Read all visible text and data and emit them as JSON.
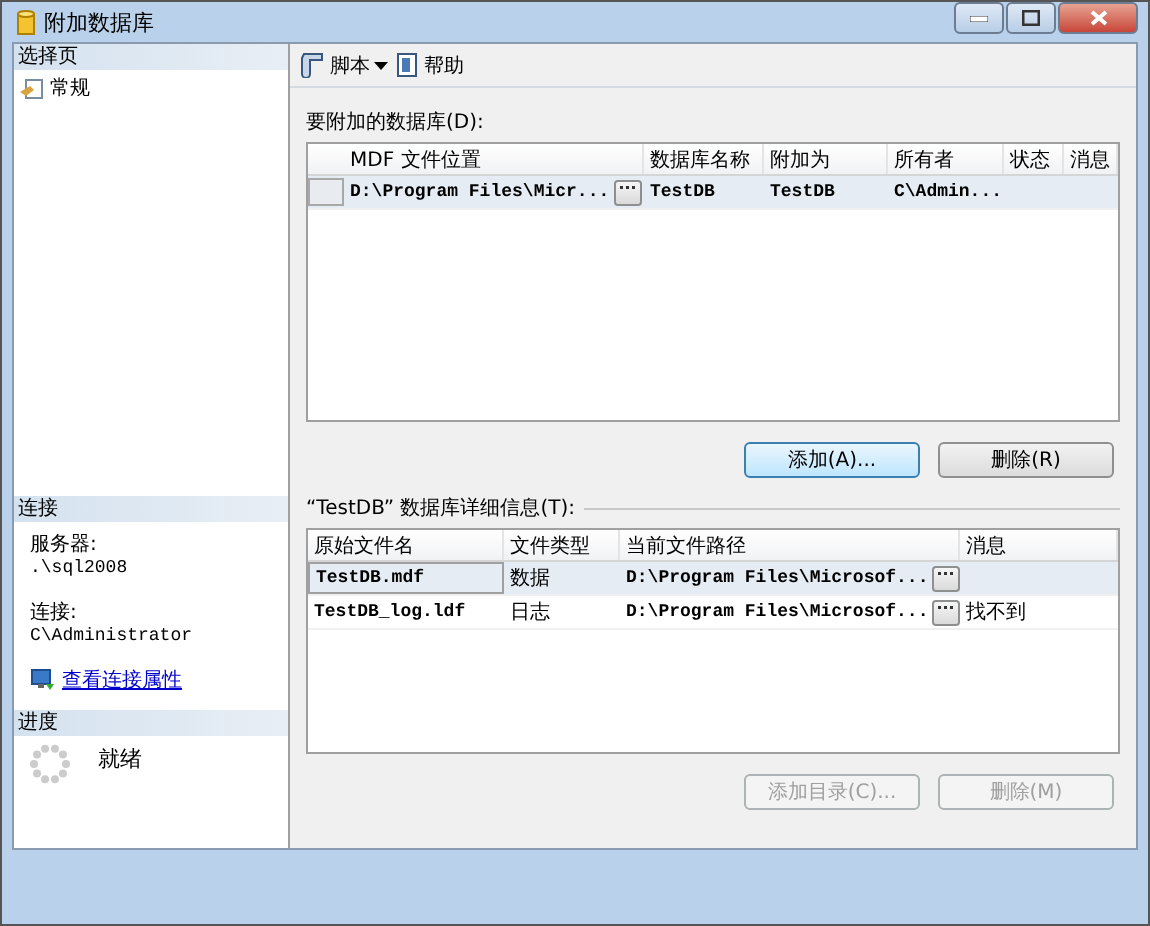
{
  "window": {
    "title": "附加数据库"
  },
  "pages": {
    "header": "选择页",
    "items": [
      {
        "label": "常规"
      }
    ]
  },
  "connection": {
    "header": "连接",
    "fields": [
      {
        "label": "服务器:",
        "value": ".\\sql2008"
      },
      {
        "label": "连接:",
        "value": "C\\Administrator"
      }
    ],
    "link": "查看连接属性"
  },
  "progress": {
    "header": "进度",
    "status": "就绪"
  },
  "toolbar": [
    {
      "label": "脚本",
      "kind": "dropdown"
    },
    {
      "label": "帮助",
      "kind": "help"
    }
  ],
  "databases": {
    "label": "要附加的数据库(D):",
    "row_header": true,
    "columns": [
      {
        "label": "MDF 文件位置",
        "kind": "path"
      },
      {
        "label": "数据库名称",
        "kind": "text"
      },
      {
        "label": "附加为",
        "kind": "text"
      },
      {
        "label": "所有者",
        "kind": "text"
      },
      {
        "label": "状态",
        "kind": "text"
      },
      {
        "label": "消息",
        "kind": "text"
      }
    ],
    "rows": [
      {
        "selected": true,
        "cells": [
          "D:\\Program Files\\Micr...",
          "TestDB",
          "TestDB",
          "C\\Admin...",
          "",
          ""
        ]
      }
    ]
  },
  "db_buttons": [
    {
      "label": "添加(A)...",
      "focused": true,
      "disabled": false
    },
    {
      "label": "删除(R)",
      "focused": false,
      "disabled": false
    }
  ],
  "details": {
    "label": "“TestDB” 数据库详细信息(T):",
    "row_header": false,
    "columns": [
      {
        "label": "原始文件名",
        "kind": "text"
      },
      {
        "label": "文件类型",
        "kind": "text"
      },
      {
        "label": "当前文件路径",
        "kind": "path"
      },
      {
        "label": "消息",
        "kind": "text"
      }
    ],
    "rows": [
      {
        "selected": true,
        "cells": [
          "TestDB.mdf",
          "数据",
          "D:\\Program Files\\Microsof...",
          ""
        ]
      },
      {
        "selected": false,
        "cells": [
          "TestDB_log.ldf",
          "日志",
          "D:\\Program Files\\Microsof...",
          "找不到"
        ]
      }
    ]
  },
  "detail_buttons": [
    {
      "label": "添加目录(C)...",
      "focused": false,
      "disabled": true
    },
    {
      "label": "删除(M)",
      "focused": false,
      "disabled": true
    }
  ]
}
